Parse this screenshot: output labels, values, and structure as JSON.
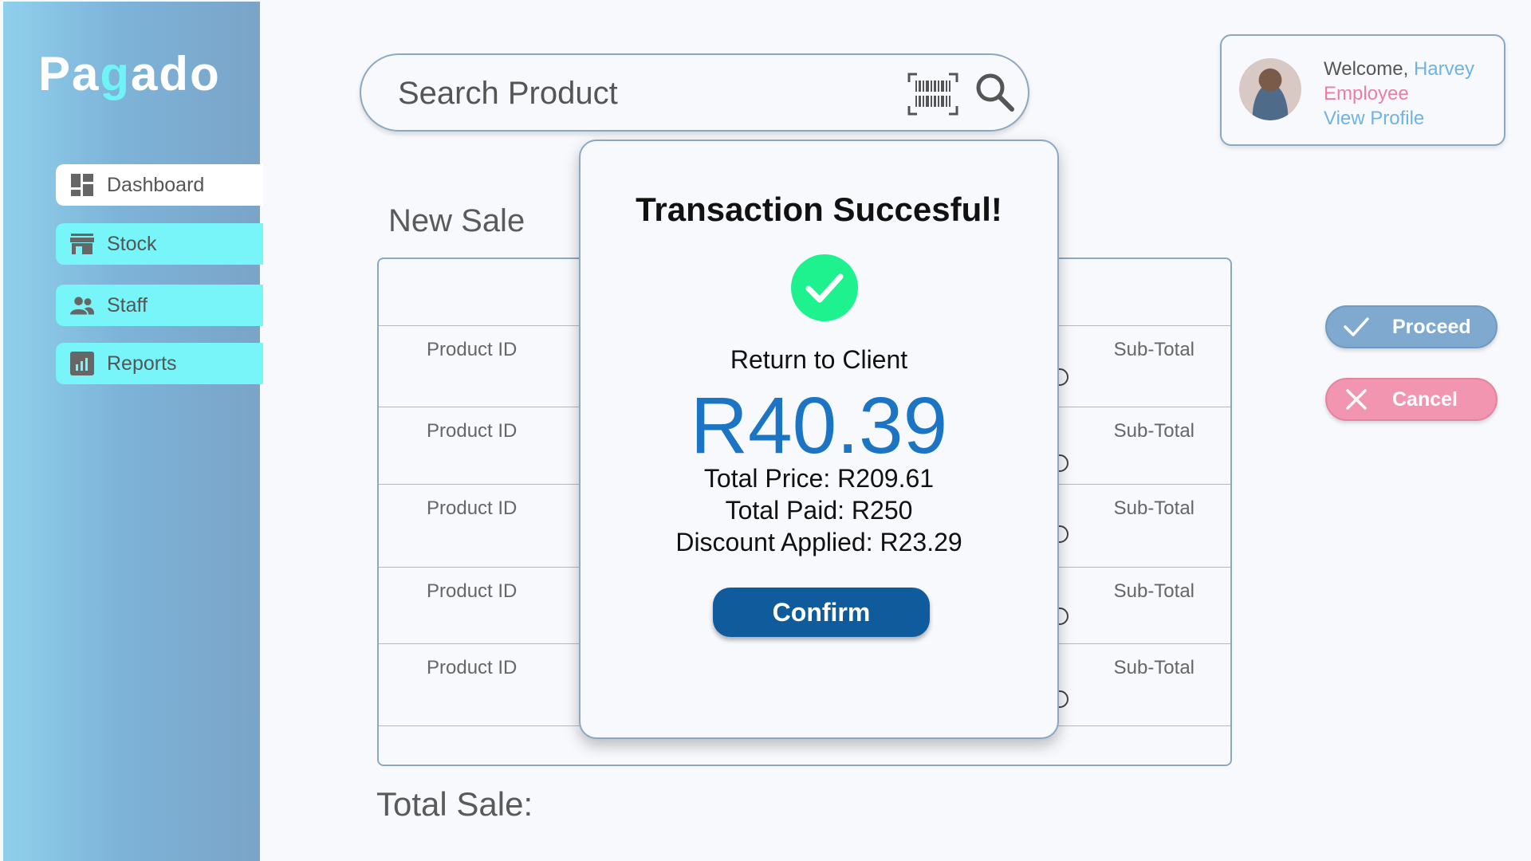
{
  "app": {
    "logo_prefix": "Pa",
    "logo_g": "g",
    "logo_suffix": "ado"
  },
  "sidebar": {
    "items": [
      {
        "label": "Dashboard",
        "icon": "dashboard-icon"
      },
      {
        "label": "Stock",
        "icon": "store-icon"
      },
      {
        "label": "Staff",
        "icon": "people-icon"
      },
      {
        "label": "Reports",
        "icon": "chart-icon"
      }
    ]
  },
  "search": {
    "placeholder": "Search Product"
  },
  "profile": {
    "welcome_label": "Welcome,",
    "name": "Harvey",
    "role": "Employee",
    "link": "View Profile"
  },
  "main": {
    "title": "New Sale",
    "total_label": "Total Sale:",
    "rows": [
      {
        "left": "Product ID",
        "right": "Sub-Total"
      },
      {
        "left": "Product ID",
        "right": "Sub-Total"
      },
      {
        "left": "Product ID",
        "right": "Sub-Total"
      },
      {
        "left": "Product ID",
        "right": "Sub-Total"
      },
      {
        "left": "Product ID",
        "right": "Sub-Total"
      }
    ]
  },
  "actions": {
    "proceed": "Proceed",
    "cancel": "Cancel"
  },
  "modal": {
    "title": "Transaction Succesful!",
    "return_label": "Return to Client",
    "amount": "R40.39",
    "total_price": "Total Price: R209.61",
    "total_paid": "Total Paid: R250",
    "discount": "Discount Applied: R23.29",
    "confirm": "Confirm"
  },
  "colors": {
    "accent": "#1b74c4",
    "confirm": "#0f5b9b",
    "success": "#1df28f",
    "nav": "#77f5f8",
    "cancel": "#f295b0",
    "proceed": "#7fa9cf"
  }
}
